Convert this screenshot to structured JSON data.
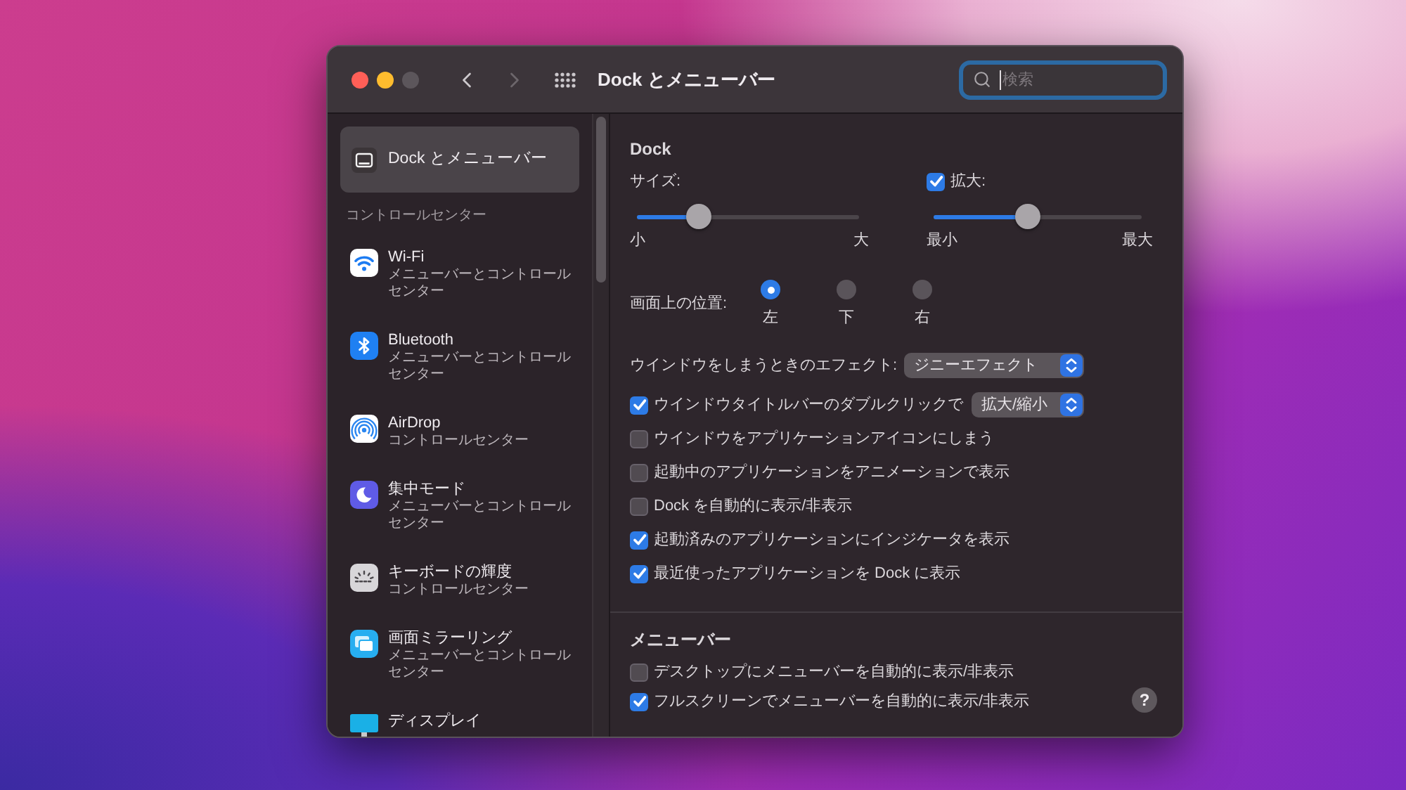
{
  "window": {
    "title": "Dock とメニューバー",
    "zoom_disabled": true,
    "forward_disabled": true
  },
  "search": {
    "placeholder": "検索",
    "focused": true
  },
  "sidebar": {
    "groups": [
      {
        "items": [
          {
            "title": "Dock とメニューバー",
            "selected": true
          }
        ]
      },
      {
        "header": "コントロールセンター",
        "items": [
          {
            "title": "Wi-Fi",
            "subtitle": "メニューバーとコントロールセンター",
            "selected": false
          },
          {
            "title": "Bluetooth",
            "subtitle": "メニューバーとコントロールセンター",
            "selected": false
          },
          {
            "title": "AirDrop",
            "subtitle": "コントロールセンター",
            "selected": false
          },
          {
            "title": "集中モード",
            "subtitle": "メニューバーとコントロールセンター",
            "selected": false
          },
          {
            "title": "キーボードの輝度",
            "subtitle": "コントロールセンター",
            "selected": false
          },
          {
            "title": "画面ミラーリング",
            "subtitle": "メニューバーとコントロールセンター",
            "selected": false
          },
          {
            "title": "ディスプレイ",
            "selected": false
          }
        ]
      }
    ]
  },
  "dock": {
    "title": "Dock",
    "size": {
      "label": "サイズ:",
      "level": 0.28,
      "min_label": "小",
      "max_label": "大"
    },
    "magnification": {
      "label": "拡大:",
      "checked": true,
      "level": 0.45,
      "min_label": "最小",
      "max_label": "最大"
    },
    "position": {
      "label": "画面上の位置:",
      "options": [
        {
          "label": "左",
          "selected": true
        },
        {
          "label": "下",
          "selected": false
        },
        {
          "label": "右",
          "selected": false
        }
      ]
    },
    "minimize_effect": {
      "label": "ウインドウをしまうときのエフェクト:",
      "value": "ジニーエフェクト"
    },
    "options": [
      {
        "label": "ウインドウタイトルバーのダブルクリックで",
        "checked": true,
        "popup": "拡大/縮小"
      },
      {
        "label": "ウインドウをアプリケーションアイコンにしまう",
        "checked": false
      },
      {
        "label": "起動中のアプリケーションをアニメーションで表示",
        "checked": false
      },
      {
        "label": "Dock を自動的に表示/非表示",
        "checked": false
      },
      {
        "label": "起動済みのアプリケーションにインジケータを表示",
        "checked": true
      },
      {
        "label": "最近使ったアプリケーションを Dock に表示",
        "checked": true
      }
    ]
  },
  "menu_bar": {
    "title": "メニューバー",
    "options": [
      {
        "label": "デスクトップにメニューバーを自動的に表示/非表示",
        "checked": false
      },
      {
        "label": "フルスクリーンでメニューバーを自動的に表示/非表示",
        "checked": true
      }
    ]
  },
  "help_button": "?"
}
